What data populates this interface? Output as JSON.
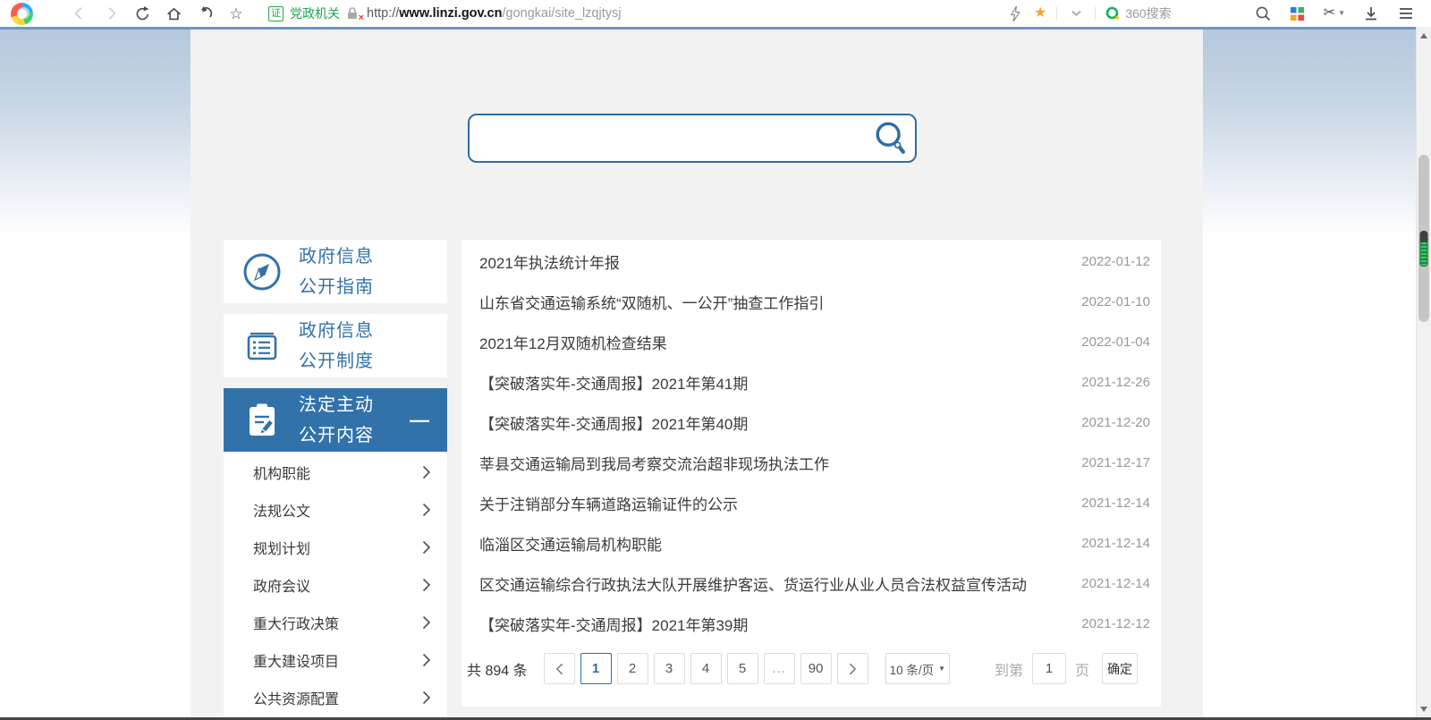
{
  "browser": {
    "badge": "证",
    "site_type": "党政机关",
    "url_scheme": "http://",
    "url_domain": "www.linzi.gov.cn",
    "url_path": "/gongkai/site_lzqjtysj",
    "search_engine": "360搜索"
  },
  "glyphs": {
    "star_outline": "☆",
    "star_filled": "★",
    "scissors": "✂",
    "dropdown_arrow": "▼",
    "lock_x": "×"
  },
  "search": {
    "value": ""
  },
  "sidebar": {
    "cards": [
      {
        "line1": "政府信息",
        "line2": "公开指南",
        "icon": "compass-icon",
        "active": false
      },
      {
        "line1": "政府信息",
        "line2": "公开制度",
        "icon": "document-icon",
        "active": false
      },
      {
        "line1": "法定主动",
        "line2": "公开内容",
        "icon": "clipboard-pencil-icon",
        "active": true,
        "collapse_glyph": "—"
      }
    ],
    "menu_items": [
      "机构职能",
      "法规公文",
      "规划计划",
      "政府会议",
      "重大行政决策",
      "重大建设项目",
      "公共资源配置"
    ]
  },
  "list": {
    "items": [
      {
        "title": "2021年执法统计年报",
        "date": "2022-01-12"
      },
      {
        "title": "山东省交通运输系统“双随机、一公开”抽查工作指引",
        "date": "2022-01-10"
      },
      {
        "title": "2021年12月双随机检查结果",
        "date": "2022-01-04"
      },
      {
        "title": "【突破落实年-交通周报】2021年第41期",
        "date": "2021-12-26"
      },
      {
        "title": "【突破落实年-交通周报】2021年第40期",
        "date": "2021-12-20"
      },
      {
        "title": "莘县交通运输局到我局考察交流治超非现场执法工作",
        "date": "2021-12-17"
      },
      {
        "title": "关于注销部分车辆道路运输证件的公示",
        "date": "2021-12-14"
      },
      {
        "title": "临淄区交通运输局机构职能",
        "date": "2021-12-14"
      },
      {
        "title": "区交通运输综合行政执法大队开展维护客运、货运行业从业人员合法权益宣传活动",
        "date": "2021-12-14"
      },
      {
        "title": "【突破落实年-交通周报】2021年第39期",
        "date": "2021-12-12"
      }
    ]
  },
  "pagination": {
    "total_label": "共 894 条",
    "prev_label": "‹",
    "next_label": "›",
    "pages": [
      "1",
      "2",
      "3",
      "4",
      "5",
      "...",
      "90"
    ],
    "active_page": "1",
    "page_size": "10 条/页",
    "goto_prefix": "到第",
    "goto_value": "1",
    "goto_suffix": "页",
    "confirm_label": "确定"
  },
  "colors": {
    "accent_blue": "#3272ab",
    "search_border": "#2e6da4",
    "panel_gray": "#f2f2f2",
    "badge_green": "#21a453",
    "star_gold": "#f5a623",
    "date_gray": "#999999",
    "gradient_top": "#b4c7dc"
  }
}
